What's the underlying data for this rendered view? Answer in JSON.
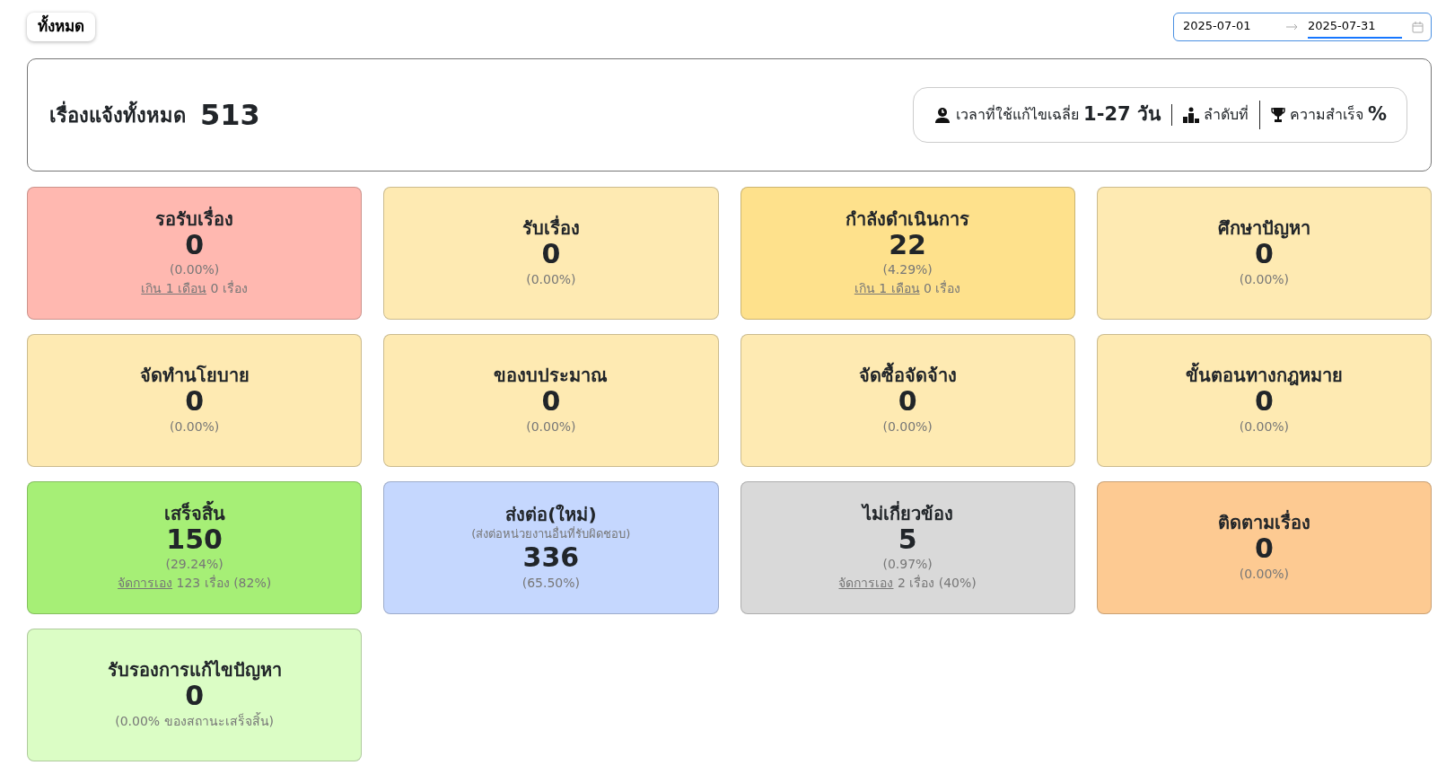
{
  "filter_button": {
    "label": "ทั้งหมด"
  },
  "date_range": [
    {
      "value": "2025-07-01",
      "selected": false
    },
    {
      "value": "2025-07-31",
      "selected": true
    }
  ],
  "summary": {
    "label": "เรื่องแจ้งทั้งหมด",
    "total": "513",
    "stats": [
      {
        "kind": "clock",
        "label": "เวลาที่ใช้แก้ไขเฉลี่ย",
        "value": "1-27 วัน"
      },
      {
        "kind": "rank",
        "label": "ลำดับที่"
      },
      {
        "kind": "trophy",
        "label": "ความสำเร็จ",
        "value": "%"
      }
    ]
  },
  "cards": [
    {
      "title": "รอรับเรื่อง",
      "value": "0",
      "percent": "(0.00%)",
      "link": "เกิน 1 เดือน",
      "link_rest": "0 เรื่อง",
      "color": "#ffb8b0"
    },
    {
      "title": "รับเรื่อง",
      "value": "0",
      "percent": "(0.00%)",
      "color": "#feeab2"
    },
    {
      "title": "กำลังดำเนินการ",
      "value": "22",
      "percent": "(4.29%)",
      "link": "เกิน 1 เดือน",
      "link_rest": "0 เรื่อง",
      "color": "#fee18c"
    },
    {
      "title": "ศึกษาปัญหา",
      "value": "0",
      "percent": "(0.00%)",
      "color": "#feeab2"
    },
    {
      "title": "จัดทำนโยบาย",
      "value": "0",
      "percent": "(0.00%)",
      "color": "#feeab2"
    },
    {
      "title": "ของบประมาณ",
      "value": "0",
      "percent": "(0.00%)",
      "color": "#feeab2"
    },
    {
      "title": "จัดซื้อจัดจ้าง",
      "value": "0",
      "percent": "(0.00%)",
      "color": "#feeab2"
    },
    {
      "title": "ขั้นตอนทางกฎหมาย",
      "value": "0",
      "percent": "(0.00%)",
      "color": "#feeab2"
    },
    {
      "title": "เสร็จสิ้น",
      "value": "150",
      "percent": "(29.24%)",
      "link": "จัดการเอง",
      "link_rest": "123 เรื่อง (82%)",
      "color": "#a6ef76"
    },
    {
      "title": "ส่งต่อ(ใหม่)",
      "subtitle": "(ส่งต่อหน่วยงานอื่นที่รับผิดชอบ)",
      "value": "336",
      "percent": "(65.50%)",
      "color": "#c5d7fe"
    },
    {
      "title": "ไม่เกี่ยวข้อง",
      "value": "5",
      "percent": "(0.97%)",
      "link": "จัดการเอง",
      "link_rest": "2 เรื่อง (40%)",
      "color": "#d9d9d9"
    },
    {
      "title": "ติดตามเรื่อง",
      "value": "0",
      "percent": "(0.00%)",
      "color": "#fdca92"
    },
    {
      "title": "รับรองการแก้ไขปัญหา",
      "value": "0",
      "percent": "(0.00% ของสถานะเสร็จสิ้น)",
      "color": "#dbfdc5"
    }
  ]
}
